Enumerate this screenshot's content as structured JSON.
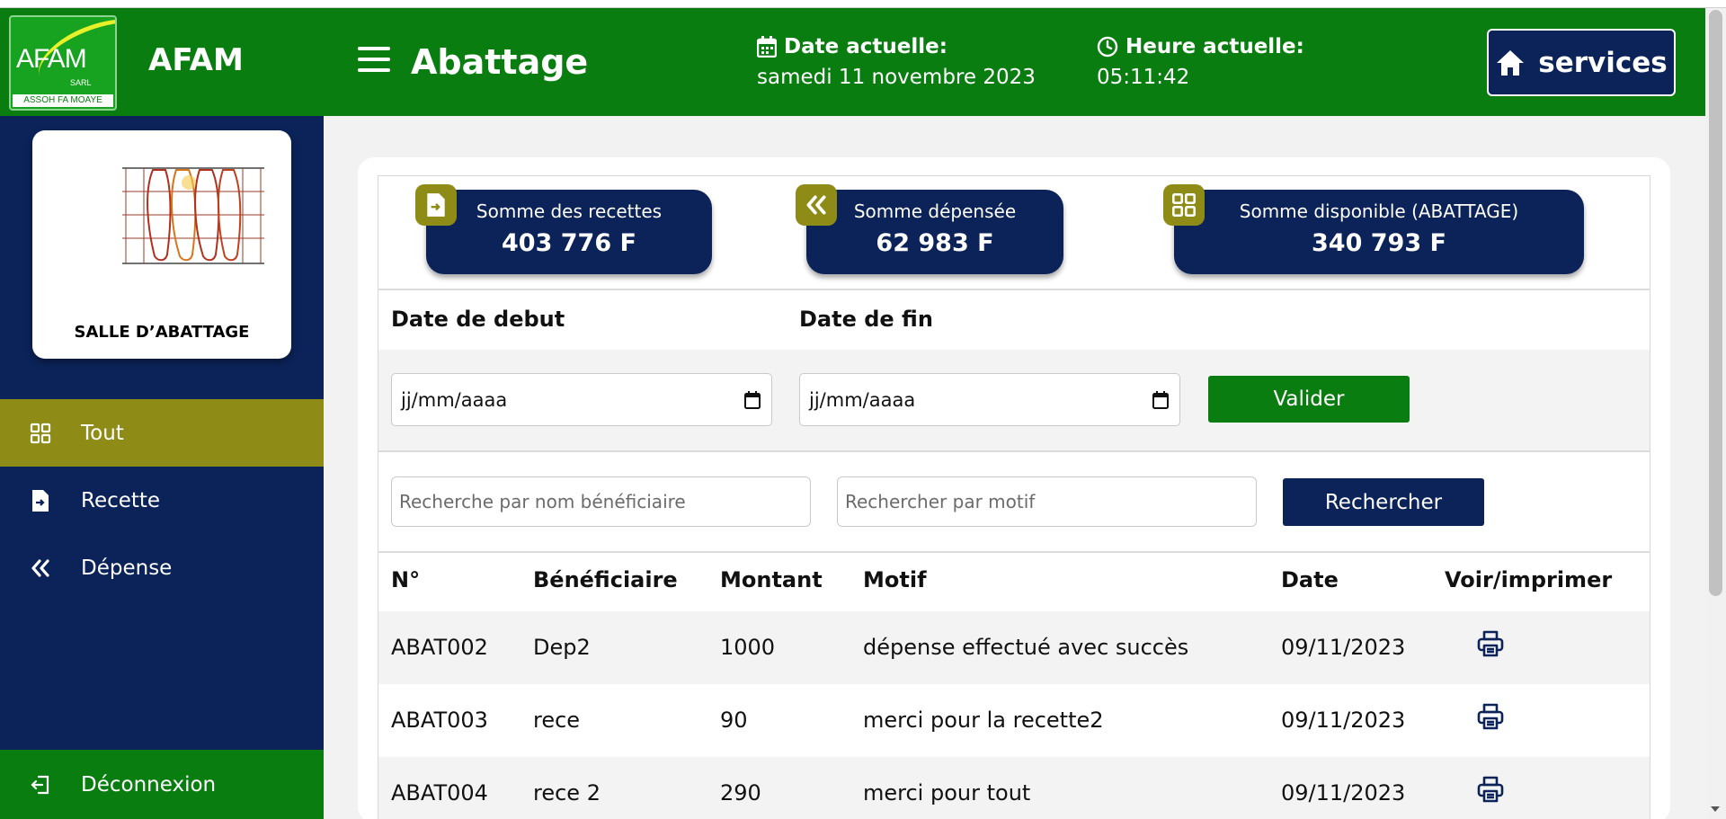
{
  "header": {
    "logo_text": "AFAM",
    "logo_sarl": "SARL",
    "logo_tagline": "ASSOH FA MOAYE",
    "brand": "AFAM",
    "page_title": "Abattage",
    "date_label": "Date actuelle:",
    "date_value": "samedi 11 novembre 2023",
    "time_label": "Heure actuelle:",
    "time_value": "05:11:42",
    "services_label": "services"
  },
  "sidebar": {
    "card_title": "SALLE D’ABATTAGE",
    "items": [
      {
        "label": "Tout",
        "icon": "grid-icon",
        "active": true
      },
      {
        "label": "Recette",
        "icon": "file-in-icon",
        "active": false
      },
      {
        "label": "Dépense",
        "icon": "double-chevron-left-icon",
        "active": false
      }
    ],
    "logout_label": "Déconnexion"
  },
  "stats": [
    {
      "label": "Somme des recettes",
      "value": "403 776 F",
      "icon": "file-in-icon"
    },
    {
      "label": "Somme dépensée",
      "value": "62 983 F",
      "icon": "double-chevron-left-icon"
    },
    {
      "label": "Somme disponible (ABATTAGE)",
      "value": "340 793 F",
      "icon": "grid-icon"
    }
  ],
  "filters": {
    "start_label": "Date de debut",
    "end_label": "Date de fin",
    "start_value": "jj/mm/aaaa",
    "end_value": "jj/mm/aaaa",
    "validate_label": "Valider"
  },
  "search": {
    "beneficiary_placeholder": "Recherche par nom bénéficiaire",
    "motif_placeholder": "Rechercher par motif",
    "search_label": "Rechercher"
  },
  "table": {
    "columns": [
      "N°",
      "Bénéficiaire",
      "Montant",
      "Motif",
      "Date",
      "Voir/imprimer"
    ],
    "rows": [
      {
        "num": "ABAT002",
        "beneficiaire": "Dep2",
        "montant": "1000",
        "motif": "dépense effectué avec succès",
        "date": "09/11/2023"
      },
      {
        "num": "ABAT003",
        "beneficiaire": "rece",
        "montant": "90",
        "motif": "merci pour la recette2",
        "date": "09/11/2023"
      },
      {
        "num": "ABAT004",
        "beneficiaire": "rece 2",
        "montant": "290",
        "motif": "merci pour tout",
        "date": "09/11/2023"
      }
    ]
  },
  "colors": {
    "header_green": "#0a7d10",
    "navy": "#0b2358",
    "olive": "#8e8b17"
  }
}
